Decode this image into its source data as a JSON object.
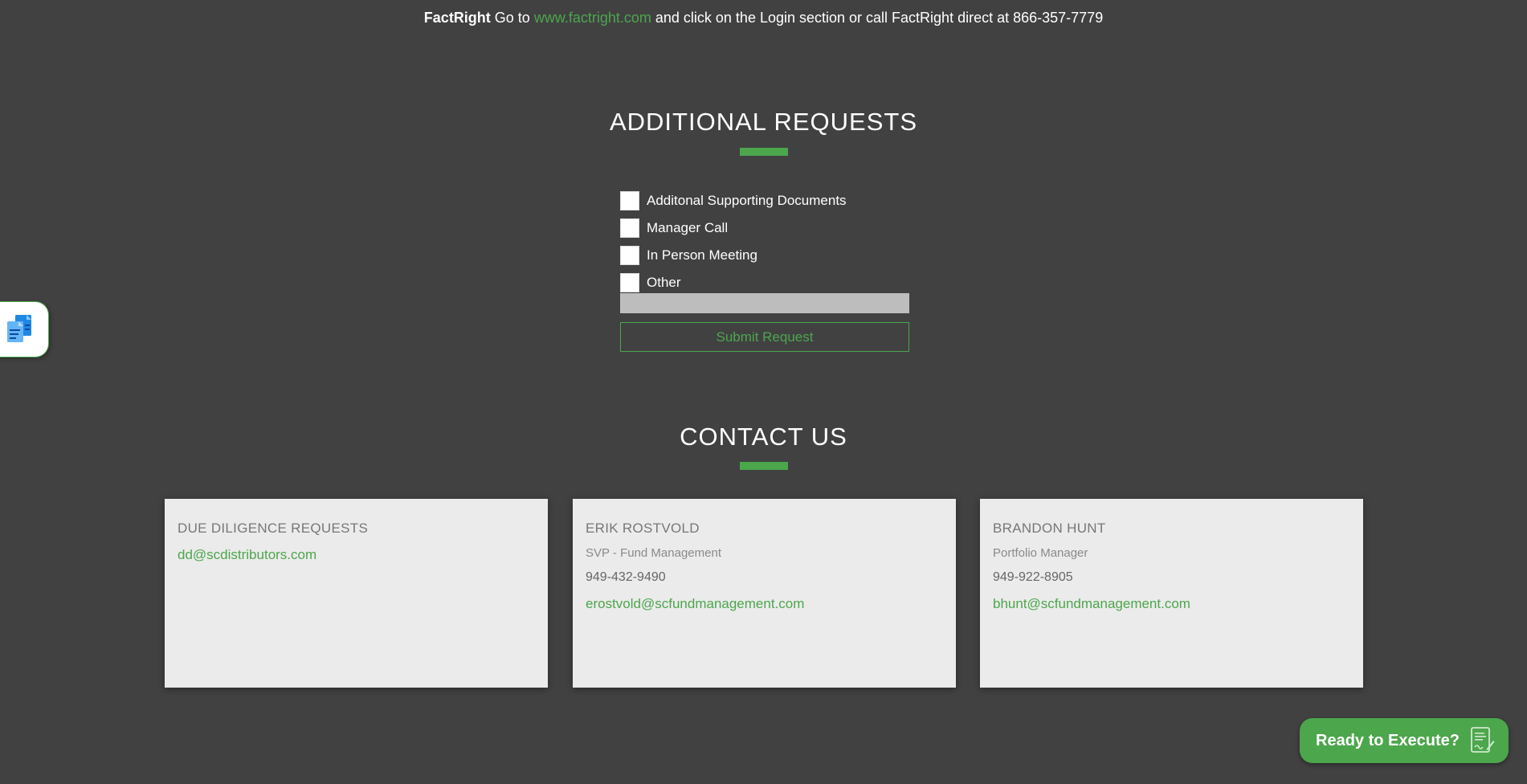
{
  "topline": {
    "brand": "FactRight",
    "prefix": " Go to ",
    "link": "www.factright.com",
    "suffix": " and click on the Login section or call FactRight direct at 866-357-7779"
  },
  "additional_requests": {
    "title": "ADDITIONAL REQUESTS",
    "options": [
      "Additonal Supporting Documents",
      "Manager Call",
      "In Person Meeting",
      "Other"
    ],
    "other_value": "",
    "submit_label": "Submit Request"
  },
  "contact": {
    "title": "CONTACT US",
    "cards": [
      {
        "name": "DUE DILIGENCE REQUESTS",
        "email": "dd@scdistributors.com"
      },
      {
        "name": "ERIK ROSTVOLD",
        "role": "SVP - Fund Management",
        "phone": "949-432-9490",
        "email": "erostvold@scfundmanagement.com"
      },
      {
        "name": "BRANDON HUNT",
        "role": "Portfolio Manager",
        "phone": "949-922-8905",
        "email": "bhunt@scfundmanagement.com"
      }
    ]
  },
  "cta": {
    "label": "Ready to Execute?",
    "icon": "document-sign-icon"
  },
  "side_tab": {
    "icon": "documents-icon"
  },
  "colors": {
    "background": "#414142",
    "accent": "#4ca64c",
    "card": "#ebebeb"
  }
}
